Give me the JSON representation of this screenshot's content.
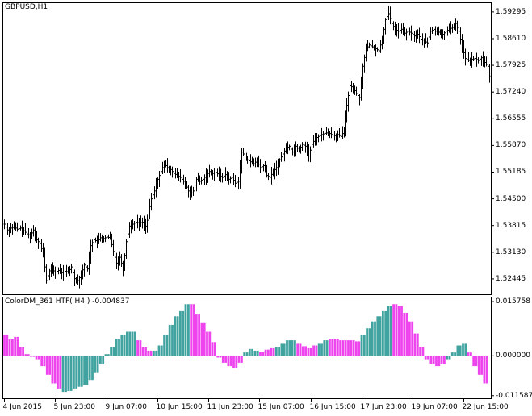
{
  "window": {
    "symbol_title": "GBPUSD,H1"
  },
  "indicator": {
    "title": "ColorDM_361 HTF( H4 ) -0.004837"
  },
  "colors": {
    "up_histogram": "#41a3a0",
    "down_histogram": "#ee44ee",
    "bars": "#000000",
    "background": "#ffffff",
    "frame": "#000000"
  },
  "chart_data": [
    {
      "type": "ohlc-bars",
      "symbol": "GBPUSD",
      "timeframe": "H1",
      "y_ticks": [
        "1.59295",
        "1.58610",
        "1.57925",
        "1.57240",
        "1.56555",
        "1.55870",
        "1.55185",
        "1.54500",
        "1.53815",
        "1.53130",
        "1.52445"
      ],
      "ylim": [
        1.5205,
        1.5952
      ],
      "x_ticks": [
        "4 Jun 2015",
        "5 Jun 23:00",
        "9 Jun 07:00",
        "10 Jun 15:00",
        "11 Jun 23:00",
        "15 Jun 07:00",
        "16 Jun 15:00",
        "17 Jun 23:00",
        "19 Jun 07:00",
        "22 Jun 15:00"
      ],
      "close_path": [
        [
          0,
          1.5385
        ],
        [
          4,
          1.537
        ],
        [
          8,
          1.5375
        ],
        [
          12,
          1.5378
        ],
        [
          16,
          1.5372
        ],
        [
          20,
          1.5375
        ],
        [
          24,
          1.5368
        ],
        [
          28,
          1.536
        ],
        [
          32,
          1.5355
        ],
        [
          36,
          1.537
        ],
        [
          40,
          1.5345
        ],
        [
          44,
          1.5335
        ],
        [
          48,
          1.531
        ],
        [
          52,
          1.524
        ],
        [
          56,
          1.5265
        ],
        [
          60,
          1.5268
        ],
        [
          64,
          1.5262
        ],
        [
          68,
          1.5266
        ],
        [
          72,
          1.526
        ],
        [
          76,
          1.5264
        ],
        [
          80,
          1.5262
        ],
        [
          84,
          1.5275
        ],
        [
          88,
          1.5245
        ],
        [
          92,
          1.524
        ],
        [
          96,
          1.5255
        ],
        [
          100,
          1.528
        ],
        [
          104,
          1.527
        ],
        [
          108,
          1.533
        ],
        [
          112,
          1.5345
        ],
        [
          116,
          1.534
        ],
        [
          120,
          1.535
        ],
        [
          124,
          1.5348
        ],
        [
          128,
          1.5352
        ],
        [
          132,
          1.535
        ],
        [
          136,
          1.5315
        ],
        [
          140,
          1.5285
        ],
        [
          144,
          1.53
        ],
        [
          148,
          1.527
        ],
        [
          152,
          1.534
        ],
        [
          156,
          1.538
        ],
        [
          160,
          1.5385
        ],
        [
          164,
          1.539
        ],
        [
          168,
          1.5388
        ],
        [
          172,
          1.539
        ],
        [
          176,
          1.538
        ],
        [
          180,
          1.541
        ],
        [
          184,
          1.545
        ],
        [
          188,
          1.547
        ],
        [
          192,
          1.55
        ],
        [
          196,
          1.552
        ],
        [
          200,
          1.554
        ],
        [
          204,
          1.553
        ],
        [
          208,
          1.5525
        ],
        [
          212,
          1.5515
        ],
        [
          216,
          1.551
        ],
        [
          220,
          1.5505
        ],
        [
          224,
          1.5495
        ],
        [
          228,
          1.548
        ],
        [
          232,
          1.546
        ],
        [
          236,
          1.547
        ],
        [
          240,
          1.55
        ],
        [
          244,
          1.5495
        ],
        [
          248,
          1.55
        ],
        [
          252,
          1.551
        ],
        [
          256,
          1.552
        ],
        [
          260,
          1.5515
        ],
        [
          264,
          1.5518
        ],
        [
          268,
          1.551
        ],
        [
          272,
          1.5505
        ],
        [
          276,
          1.5512
        ],
        [
          280,
          1.55
        ],
        [
          284,
          1.5505
        ],
        [
          288,
          1.549
        ],
        [
          292,
          1.5495
        ],
        [
          296,
          1.557
        ],
        [
          300,
          1.556
        ],
        [
          304,
          1.555
        ],
        [
          308,
          1.5545
        ],
        [
          312,
          1.554
        ],
        [
          316,
          1.5548
        ],
        [
          320,
          1.553
        ],
        [
          324,
          1.5535
        ],
        [
          328,
          1.551
        ],
        [
          332,
          1.5505
        ],
        [
          336,
          1.552
        ],
        [
          340,
          1.553
        ],
        [
          344,
          1.555
        ],
        [
          348,
          1.5565
        ],
        [
          352,
          1.558
        ],
        [
          356,
          1.5585
        ],
        [
          360,
          1.557
        ],
        [
          364,
          1.5585
        ],
        [
          368,
          1.5575
        ],
        [
          372,
          1.559
        ],
        [
          376,
          1.5585
        ],
        [
          380,
          1.556
        ],
        [
          384,
          1.559
        ],
        [
          388,
          1.5605
        ],
        [
          392,
          1.561
        ],
        [
          396,
          1.5615
        ],
        [
          400,
          1.5618
        ],
        [
          404,
          1.562
        ],
        [
          408,
          1.5615
        ],
        [
          412,
          1.5612
        ],
        [
          416,
          1.5615
        ],
        [
          420,
          1.561
        ],
        [
          424,
          1.5625
        ],
        [
          428,
          1.569
        ],
        [
          432,
          1.574
        ],
        [
          436,
          1.5735
        ],
        [
          440,
          1.572
        ],
        [
          444,
          1.571
        ],
        [
          448,
          1.579
        ],
        [
          452,
          1.5835
        ],
        [
          456,
          1.5845
        ],
        [
          460,
          1.584
        ],
        [
          464,
          1.5835
        ],
        [
          468,
          1.583
        ],
        [
          472,
          1.586
        ],
        [
          476,
          1.591
        ],
        [
          480,
          1.5925
        ],
        [
          484,
          1.59
        ],
        [
          488,
          1.5885
        ],
        [
          492,
          1.588
        ],
        [
          496,
          1.5885
        ],
        [
          500,
          1.5875
        ],
        [
          504,
          1.588
        ],
        [
          508,
          1.5875
        ],
        [
          512,
          1.5868
        ],
        [
          516,
          1.5872
        ],
        [
          520,
          1.586
        ],
        [
          524,
          1.5855
        ],
        [
          528,
          1.585
        ],
        [
          532,
          1.588
        ],
        [
          536,
          1.5885
        ],
        [
          540,
          1.5875
        ],
        [
          544,
          1.588
        ],
        [
          548,
          1.5872
        ],
        [
          552,
          1.588
        ],
        [
          556,
          1.5885
        ],
        [
          560,
          1.589
        ],
        [
          564,
          1.59
        ],
        [
          568,
          1.588
        ],
        [
          572,
          1.584
        ],
        [
          576,
          1.581
        ],
        [
          580,
          1.5805
        ],
        [
          584,
          1.5808
        ],
        [
          588,
          1.581
        ],
        [
          592,
          1.5805
        ],
        [
          596,
          1.5812
        ],
        [
          600,
          1.58
        ],
        [
          604,
          1.579
        ],
        [
          606,
          1.5765
        ]
      ]
    },
    {
      "type": "bar",
      "name": "ColorDM_361 HTF( H4 )",
      "y_ticks": [
        "0.015758",
        "0.000000",
        "-0.011587"
      ],
      "ylim": [
        -0.01234,
        0.01695
      ],
      "bar_width_hours": 4,
      "segments": [
        {
          "dir": "down",
          "values": [
            0.006,
            0.006,
            0.0048,
            0.0048,
            0.0055,
            0.0055,
            0.0025,
            0.0025,
            0.0005,
            0.0005
          ]
        },
        {
          "dir": "down",
          "values": [
            -0.0003,
            -0.0003,
            -0.001,
            -0.001,
            -0.003,
            -0.003,
            -0.0055,
            -0.0055,
            -0.008,
            -0.008,
            -0.0095,
            -0.0095
          ]
        },
        {
          "dir": "up",
          "values": [
            -0.0105,
            -0.0105,
            -0.0102,
            -0.0102,
            -0.0095,
            -0.0095,
            -0.009,
            -0.009,
            -0.0085,
            -0.0085,
            -0.007,
            -0.007,
            -0.005,
            -0.005,
            -0.0025,
            -0.0025,
            0.0005,
            0.0005,
            0.0025,
            0.0025,
            0.005,
            0.005,
            0.006,
            0.006,
            0.007,
            0.007,
            0.007,
            0.007
          ]
        },
        {
          "dir": "down",
          "values": [
            0.0045,
            0.0045,
            0.0025,
            0.0025,
            0.0015,
            0.0015
          ]
        },
        {
          "dir": "up",
          "values": [
            0.0015,
            0.0015,
            0.003,
            0.003,
            0.006,
            0.006,
            0.009,
            0.009,
            0.0115,
            0.0115,
            0.013,
            0.013,
            0.015,
            0.015
          ]
        },
        {
          "dir": "down",
          "values": [
            0.015,
            0.015,
            0.012,
            0.012,
            0.0095,
            0.0095,
            0.007,
            0.007,
            0.004,
            0.004,
            -0.0005,
            -0.0005,
            -0.002,
            -0.002,
            -0.003,
            -0.003,
            -0.0035,
            -0.0035,
            -0.002,
            -0.002
          ]
        },
        {
          "dir": "up",
          "values": [
            0.001,
            0.001,
            0.002,
            0.002,
            0.0015,
            0.0015
          ]
        },
        {
          "dir": "down",
          "values": [
            0.0012,
            0.0012,
            0.0018,
            0.0018,
            0.0022,
            0.0022
          ]
        },
        {
          "dir": "up",
          "values": [
            0.0025,
            0.0025,
            0.0035,
            0.0035,
            0.0045,
            0.0045,
            0.0045,
            0.0045
          ]
        },
        {
          "dir": "down",
          "values": [
            0.0035,
            0.0035,
            0.0028,
            0.0028,
            0.0022,
            0.0022,
            0.003,
            0.003
          ]
        },
        {
          "dir": "up",
          "values": [
            0.0035,
            0.0035,
            0.0045,
            0.0045
          ]
        },
        {
          "dir": "down",
          "values": [
            0.005,
            0.005,
            0.005,
            0.005,
            0.0045,
            0.0045,
            0.0045,
            0.0045,
            0.0045,
            0.0045,
            0.0042,
            0.0042
          ]
        },
        {
          "dir": "up",
          "values": [
            0.006,
            0.006,
            0.008,
            0.008,
            0.01,
            0.01,
            0.0115,
            0.0115,
            0.013,
            0.013,
            0.0145,
            0.0145
          ]
        },
        {
          "dir": "down",
          "values": [
            0.015,
            0.015,
            0.0145,
            0.0145,
            0.0125,
            0.0125,
            0.01,
            0.01,
            0.0065,
            0.0065,
            0.0025,
            0.0025,
            -0.001,
            -0.001,
            -0.0025,
            -0.0025,
            -0.003,
            -0.003,
            -0.0025,
            -0.0025
          ]
        },
        {
          "dir": "up",
          "values": [
            -0.001,
            -0.001,
            0.001,
            0.001,
            0.003,
            0.003,
            0.0035,
            0.0035
          ]
        },
        {
          "dir": "down",
          "values": [
            0.001,
            0.001,
            -0.003,
            -0.003,
            -0.0055,
            -0.0055,
            -0.008,
            -0.008
          ]
        }
      ]
    }
  ]
}
